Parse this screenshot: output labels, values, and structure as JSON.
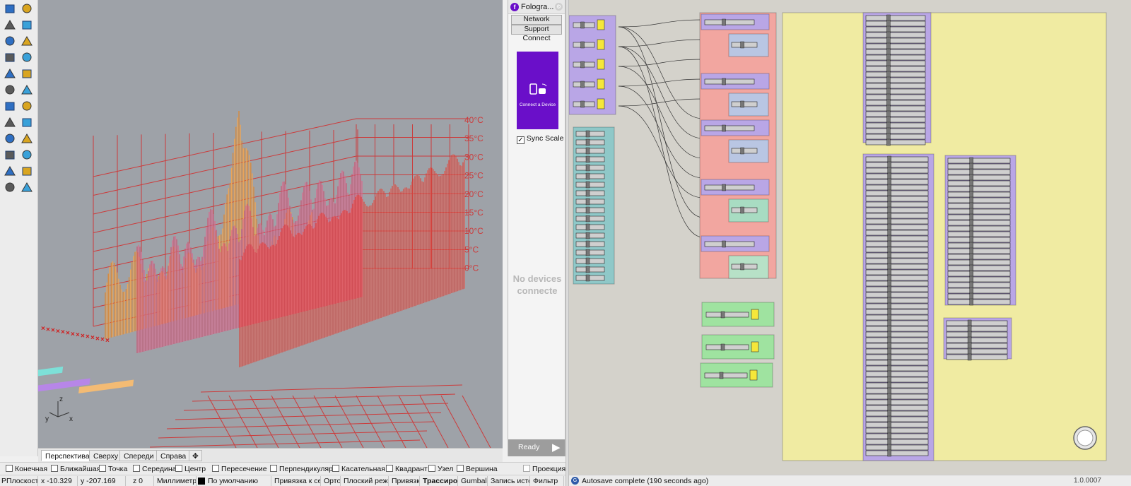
{
  "viewport": {
    "axis_labels": [
      "40°C",
      "35°C",
      "30°C",
      "25°C",
      "20°C",
      "15°C",
      "10°C",
      "5°C",
      "0°C"
    ],
    "axis_gizmo": {
      "x": "x",
      "y": "y",
      "z": "z"
    }
  },
  "viewport_tabs": [
    "Перспектива",
    "Сверху",
    "Спереди",
    "Справа"
  ],
  "snaps": [
    "Конечная",
    "Ближайшая",
    "Точка",
    "Середина",
    "Центр",
    "Пересечение",
    "Перпендикуляр",
    "Касательная",
    "Квадрант",
    "Узел",
    "Вершина",
    "Проекция"
  ],
  "statusbar": {
    "plane": "PПлоскост",
    "x": "x -10.329",
    "y": "y -207.169",
    "z": "z 0",
    "units": "Миллиметр",
    "layer": "По умолчанию",
    "grid_snap": "Привязка к сет",
    "ortho": "Орто",
    "planar": "Плоский режи",
    "osnap": "Привязка",
    "smarttrack": "Трассиров",
    "gumball": "Gumball",
    "history": "Запись истори",
    "filter": "Фильтр"
  },
  "fologram": {
    "title": "Fologra...",
    "buttons": [
      "Network",
      "Support"
    ],
    "connect_label": "Connect",
    "card_text": "Connect a Device",
    "sync_scale": "Sync Scale",
    "no_devices": "No devices connecte",
    "ready": "Ready"
  },
  "grasshopper": {
    "status": "Autosave complete (190 seconds ago)",
    "version": "1.0.0007"
  },
  "colors": {
    "viewport_bg": "#9ea2a8",
    "grid_red": "#cc3b3b",
    "gh_canvas": "#d4d2cb",
    "group_purple": "#b9a6e6",
    "group_teal": "#8fc8c8",
    "group_pink": "#f2a6a0",
    "group_green": "#9fe3a0",
    "group_yellow": "#f0eba2",
    "fologram_purple": "#6a0fc9"
  }
}
